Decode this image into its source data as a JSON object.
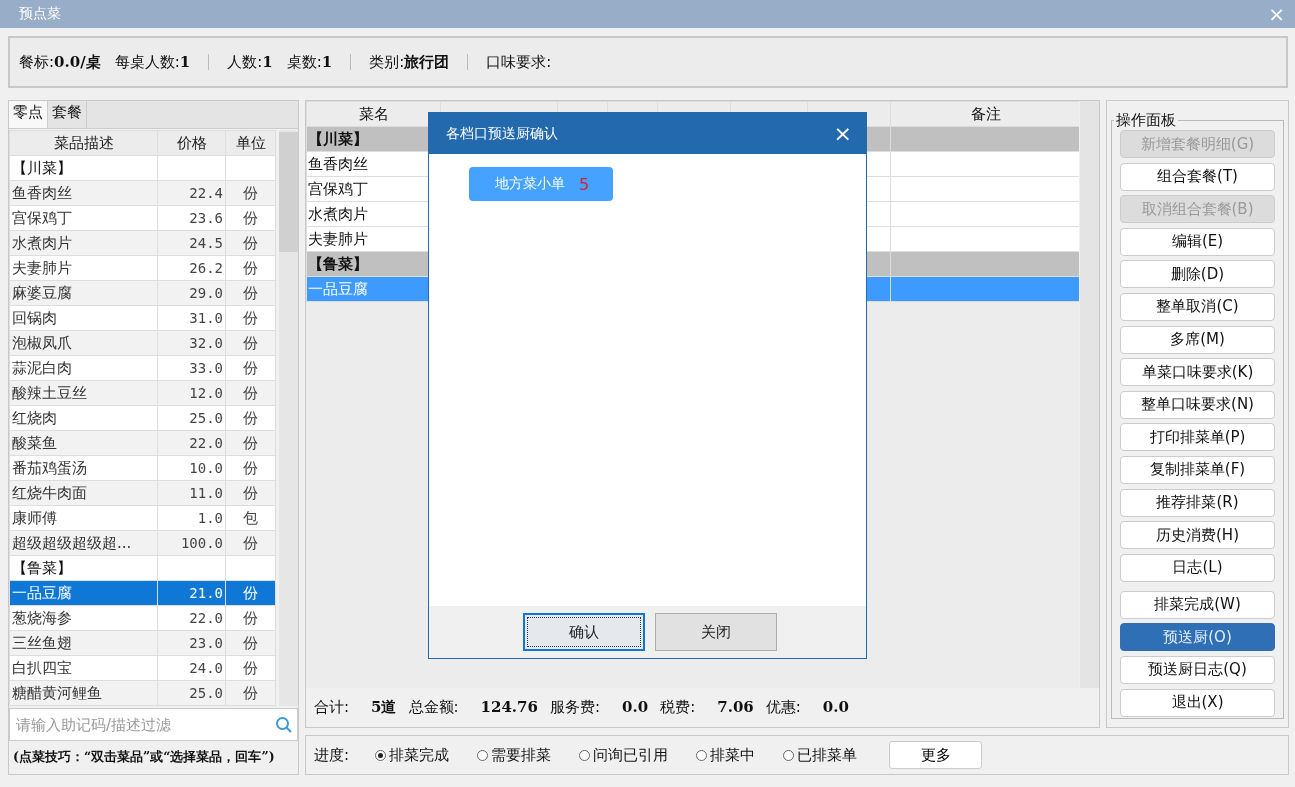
{
  "window": {
    "title": "预点菜",
    "close": "×"
  },
  "info_bar": {
    "groups": [
      [
        {
          "label": "餐标:",
          "value": "0.0/桌"
        },
        {
          "label": "每桌人数:",
          "value": "1"
        }
      ],
      [
        {
          "label": "人数:",
          "value": "1"
        },
        {
          "label": "桌数:",
          "value": "1"
        }
      ],
      [
        {
          "label": "类别:",
          "value": "旅行团"
        }
      ],
      [
        {
          "label": "口味要求:"
        }
      ]
    ]
  },
  "menu_panel": {
    "tabs": [
      {
        "label": "零点",
        "selected": true
      },
      {
        "label": "套餐",
        "selected": false
      }
    ],
    "columns": [
      "菜品描述",
      "价格",
      "单位"
    ],
    "rows": [
      {
        "kind": "group",
        "name": "【川菜】"
      },
      {
        "kind": "item",
        "name": "鱼香肉丝",
        "price": "22.4",
        "unit": "份",
        "selected": false
      },
      {
        "kind": "item",
        "name": "宫保鸡丁",
        "price": "23.6",
        "unit": "份",
        "selected": false
      },
      {
        "kind": "item",
        "name": "水煮肉片",
        "price": "24.5",
        "unit": "份",
        "selected": false
      },
      {
        "kind": "item",
        "name": "夫妻肺片",
        "price": "26.2",
        "unit": "份",
        "selected": false
      },
      {
        "kind": "item",
        "name": "麻婆豆腐",
        "price": "29.0",
        "unit": "份",
        "selected": false
      },
      {
        "kind": "item",
        "name": "回锅肉",
        "price": "31.0",
        "unit": "份",
        "selected": false
      },
      {
        "kind": "item",
        "name": "泡椒凤爪",
        "price": "32.0",
        "unit": "份",
        "selected": false
      },
      {
        "kind": "item",
        "name": "蒜泥白肉",
        "price": "33.0",
        "unit": "份",
        "selected": false
      },
      {
        "kind": "item",
        "name": "酸辣土豆丝",
        "price": "12.0",
        "unit": "份",
        "selected": false
      },
      {
        "kind": "item",
        "name": "红烧肉",
        "price": "25.0",
        "unit": "份",
        "selected": false
      },
      {
        "kind": "item",
        "name": "酸菜鱼",
        "price": "22.0",
        "unit": "份",
        "selected": false
      },
      {
        "kind": "item",
        "name": "番茄鸡蛋汤",
        "price": "10.0",
        "unit": "份",
        "selected": false
      },
      {
        "kind": "item",
        "name": "红烧牛肉面",
        "price": "11.0",
        "unit": "份",
        "selected": false
      },
      {
        "kind": "item",
        "name": "康师傅",
        "price": "1.0",
        "unit": "包",
        "selected": false
      },
      {
        "kind": "item",
        "name": "超级超级超级超...",
        "price": "100.0",
        "unit": "份",
        "selected": false
      },
      {
        "kind": "group",
        "name": "【鲁菜】"
      },
      {
        "kind": "item",
        "name": "一品豆腐",
        "price": "21.0",
        "unit": "份",
        "selected": true
      },
      {
        "kind": "item",
        "name": "葱烧海参",
        "price": "22.0",
        "unit": "份",
        "selected": false
      },
      {
        "kind": "item",
        "name": "三丝鱼翅",
        "price": "23.0",
        "unit": "份",
        "selected": false
      },
      {
        "kind": "item",
        "name": "白扒四宝",
        "price": "24.0",
        "unit": "份",
        "selected": false
      },
      {
        "kind": "item",
        "name": "糖醋黄河鲤鱼",
        "price": "25.0",
        "unit": "份",
        "selected": false
      }
    ],
    "search": {
      "placeholder": "请输入助记码/描述过滤"
    },
    "tip": "(点菜技巧：“双击菜品”或“选择菜品，回车”)"
  },
  "order_panel": {
    "name_column": "菜名",
    "remark_column": "备注",
    "rows": [
      {
        "kind": "group",
        "name": "【川菜】"
      },
      {
        "kind": "item",
        "name": "鱼香肉丝",
        "selected": false
      },
      {
        "kind": "item",
        "name": "宫保鸡丁",
        "selected": false
      },
      {
        "kind": "item",
        "name": "水煮肉片",
        "selected": false
      },
      {
        "kind": "item",
        "name": "夫妻肺片",
        "selected": false
      },
      {
        "kind": "group",
        "name": "【鲁菜】"
      },
      {
        "kind": "item",
        "name": "一品豆腐",
        "selected": true
      }
    ],
    "totals": [
      {
        "label": "合计:",
        "value": "5道"
      },
      {
        "label": "总金额:",
        "value": "124.76"
      },
      {
        "label": "服务费:",
        "value": "0.0"
      },
      {
        "label": "税费:",
        "value": "7.06"
      },
      {
        "label": "优惠:",
        "value": "0.0"
      }
    ]
  },
  "operation_panel": {
    "title": "操作面板",
    "groups": [
      [
        {
          "label": "新增套餐明细(G)",
          "disabled": true,
          "active": false
        },
        {
          "label": "组合套餐(T)",
          "disabled": false,
          "active": false
        },
        {
          "label": "取消组合套餐(B)",
          "disabled": true,
          "active": false
        },
        {
          "label": "编辑(E)",
          "disabled": false,
          "active": false
        },
        {
          "label": "删除(D)",
          "disabled": false,
          "active": false
        },
        {
          "label": "整单取消(C)",
          "disabled": false,
          "active": false
        },
        {
          "label": "多席(M)",
          "disabled": false,
          "active": false
        },
        {
          "label": "单菜口味要求(K)",
          "disabled": false,
          "active": false
        },
        {
          "label": "整单口味要求(N)",
          "disabled": false,
          "active": false
        },
        {
          "label": "打印排菜单(P)",
          "disabled": false,
          "active": false
        },
        {
          "label": "复制排菜单(F)",
          "disabled": false,
          "active": false
        },
        {
          "label": "推荐排菜(R)",
          "disabled": false,
          "active": false
        },
        {
          "label": "历史消费(H)",
          "disabled": false,
          "active": false
        },
        {
          "label": "日志(L)",
          "disabled": false,
          "active": false
        }
      ],
      [
        {
          "label": "排菜完成(W)",
          "disabled": false,
          "active": false
        },
        {
          "label": "预送厨(O)",
          "disabled": false,
          "active": true
        },
        {
          "label": "预送厨日志(Q)",
          "disabled": false,
          "active": false
        },
        {
          "label": "退出(X)",
          "disabled": false,
          "active": false
        }
      ]
    ]
  },
  "progress_bar": {
    "label": "进度:",
    "options": [
      {
        "label": "排菜完成",
        "selected": true
      },
      {
        "label": "需要排菜",
        "selected": false
      },
      {
        "label": "问询已引用",
        "selected": false
      },
      {
        "label": "排菜中",
        "selected": false
      },
      {
        "label": "已排菜单",
        "selected": false
      }
    ],
    "more_button": "更多"
  },
  "dialog": {
    "title": "各档口预送厨确认",
    "close": "×",
    "stations": [
      {
        "label": "地方菜小单",
        "count": "5"
      }
    ],
    "buttons": [
      {
        "label": "确认",
        "focused": true
      },
      {
        "label": "关闭",
        "focused": false
      }
    ]
  }
}
